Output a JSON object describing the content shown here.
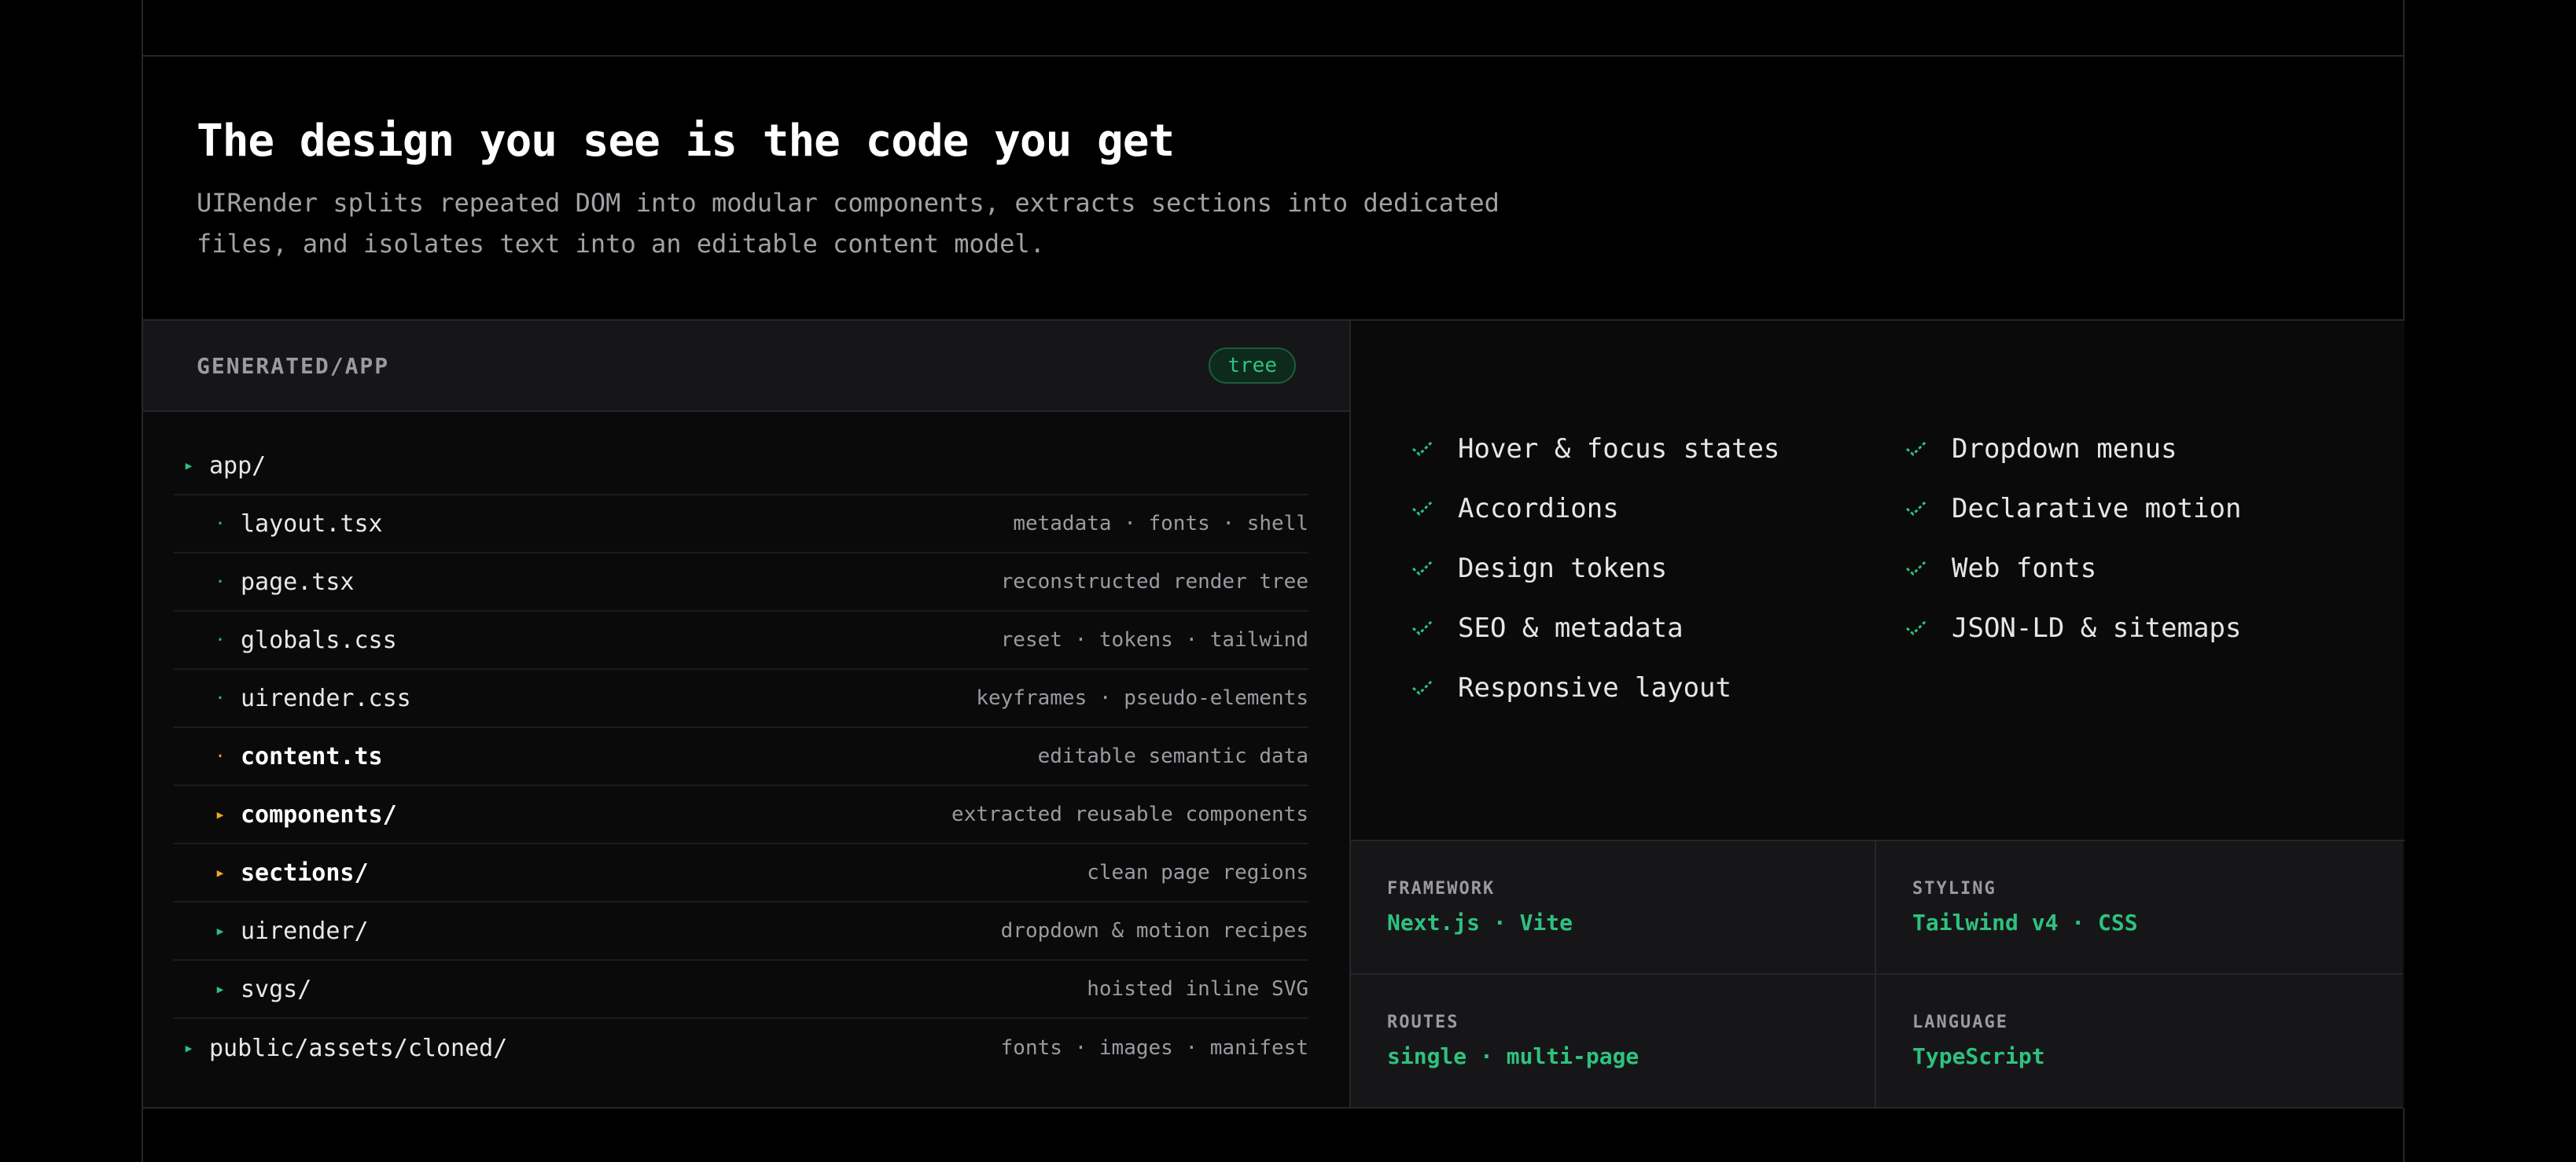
{
  "hero": {
    "title": "The design you see is the code you get",
    "subtitle": "UIRender splits repeated DOM into modular components, extracts sections into dedicated files, and isolates text into an editable content model."
  },
  "tree_panel": {
    "label": "GENERATED/APP",
    "badge": "tree",
    "rows": [
      {
        "name": "app/",
        "desc": "",
        "bullet": "▸",
        "color": "#2ec27e",
        "level": 0,
        "bold": false
      },
      {
        "name": "layout.tsx",
        "desc": "metadata · fonts · shell",
        "bullet": "·",
        "color": "#2ec27e",
        "level": 1,
        "bold": false
      },
      {
        "name": "page.tsx",
        "desc": "reconstructed render tree",
        "bullet": "·",
        "color": "#2ec27e",
        "level": 1,
        "bold": false
      },
      {
        "name": "globals.css",
        "desc": "reset · tokens · tailwind",
        "bullet": "·",
        "color": "#2ec27e",
        "level": 1,
        "bold": false
      },
      {
        "name": "uirender.css",
        "desc": "keyframes · pseudo-elements",
        "bullet": "·",
        "color": "#2ec27e",
        "level": 1,
        "bold": false
      },
      {
        "name": "content.ts",
        "desc": "editable semantic data",
        "bullet": "·",
        "color": "#f5a623",
        "level": 1,
        "bold": true
      },
      {
        "name": "components/",
        "desc": "extracted reusable components",
        "bullet": "▸",
        "color": "#f5a623",
        "level": 1,
        "bold": true
      },
      {
        "name": "sections/",
        "desc": "clean page regions",
        "bullet": "▸",
        "color": "#f5a623",
        "level": 1,
        "bold": true
      },
      {
        "name": "uirender/",
        "desc": "dropdown & motion recipes",
        "bullet": "▸",
        "color": "#2ec27e",
        "level": 1,
        "bold": false
      },
      {
        "name": "svgs/",
        "desc": "hoisted inline SVG",
        "bullet": "▸",
        "color": "#2ec27e",
        "level": 1,
        "bold": false
      },
      {
        "name": "public/assets/cloned/",
        "desc": "fonts · images · manifest",
        "bullet": "▸",
        "color": "#2ec27e",
        "level": 0,
        "bold": false
      }
    ]
  },
  "features": [
    "Hover & focus states",
    "Dropdown menus",
    "Accordions",
    "Declarative motion",
    "Design tokens",
    "Web fonts",
    "SEO & metadata",
    "JSON-LD & sitemaps",
    "Responsive layout"
  ],
  "check_icon": "check-icon",
  "specs": [
    {
      "key": "FRAMEWORK",
      "value": "Next.js · Vite"
    },
    {
      "key": "STYLING",
      "value": "Tailwind v4 · CSS"
    },
    {
      "key": "ROUTES",
      "value": "single · multi-page"
    },
    {
      "key": "LANGUAGE",
      "value": "TypeScript"
    }
  ],
  "colors": {
    "accent": "#2ec27e",
    "highlight": "#f5a623",
    "background": "#000000"
  }
}
